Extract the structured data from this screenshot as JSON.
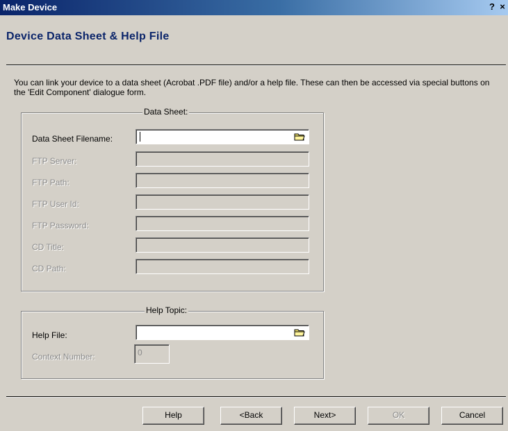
{
  "window": {
    "title": "Make Device",
    "help_button": "?",
    "close_button": "×"
  },
  "header": {
    "title": "Device Data Sheet & Help File"
  },
  "intro_text": "You can link your device to a data sheet (Acrobat .PDF file) and/or a help file. These can then be accessed via special buttons on the 'Edit Component' dialogue form.",
  "data_sheet": {
    "group_title": "Data Sheet:",
    "fields": [
      {
        "label": "Data Sheet Filename:",
        "value": "",
        "enabled": true
      },
      {
        "label": "FTP Server:",
        "value": "",
        "enabled": false
      },
      {
        "label": "FTP Path:",
        "value": "",
        "enabled": false
      },
      {
        "label": "FTP User Id:",
        "value": "",
        "enabled": false
      },
      {
        "label": "FTP Password:",
        "value": "",
        "enabled": false
      },
      {
        "label": "CD Title:",
        "value": "",
        "enabled": false
      },
      {
        "label": "CD Path:",
        "value": "",
        "enabled": false
      }
    ]
  },
  "help_topic": {
    "group_title": "Help Topic:",
    "help_file_label": "Help File:",
    "help_file_value": "",
    "context_number_label": "Context Number:",
    "context_number_value": "0"
  },
  "buttons": {
    "help": "Help",
    "back": "<Back",
    "next": "Next>",
    "ok": "OK",
    "cancel": "Cancel"
  },
  "colors": {
    "title_bar_start": "#0a246a",
    "title_bar_end": "#a6caf0",
    "header_text": "#0a246a",
    "dialog_bg": "#d4d0c8"
  },
  "icons": {
    "browse": "folder-icon"
  }
}
